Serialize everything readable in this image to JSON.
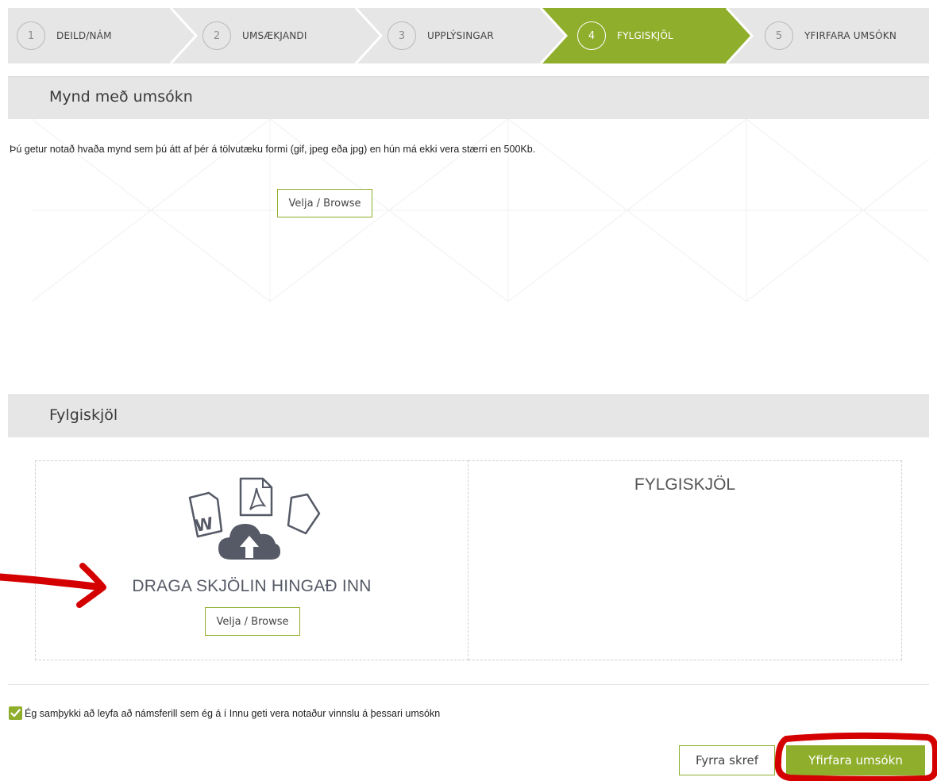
{
  "steps": [
    {
      "num": "1",
      "label": "DEILD/NÁM"
    },
    {
      "num": "2",
      "label": "UMSÆKJANDI"
    },
    {
      "num": "3",
      "label": "UPPLÝSINGAR"
    },
    {
      "num": "4",
      "label": "FYLGISKJÖL"
    },
    {
      "num": "5",
      "label": "YFIRFARA UMSÓKN"
    }
  ],
  "active_step": 4,
  "photo_section": {
    "title": "Mynd með umsókn",
    "description": "Þú getur notað hvaða mynd sem þú átt af þér á tölvutæku formi (gif, jpeg eða jpg) en hún má ekki vera stærri en 500Kb.",
    "browse_label": "Velja / Browse"
  },
  "attachments_section": {
    "title": "Fylgiskjöl",
    "drop_text": "DRAGA SKJÖLIN HINGAÐ INN",
    "browse_label": "Velja / Browse",
    "list_title": "FYLGISKJÖL",
    "icons": [
      "word-file-icon",
      "pdf-file-icon",
      "file-icon",
      "cloud-upload-icon"
    ]
  },
  "consent": {
    "checked": true,
    "text": "Ég samþykki að leyfa að námsferill sem ég á í Innu geti vera notaður vinnslu á þessari umsókn"
  },
  "nav": {
    "prev_label": "Fyrra skref",
    "next_label": "Yfirfara umsókn"
  },
  "colors": {
    "accent": "#8fae2c",
    "step_bg": "#e6e6e6",
    "annotation": "#d40000"
  }
}
